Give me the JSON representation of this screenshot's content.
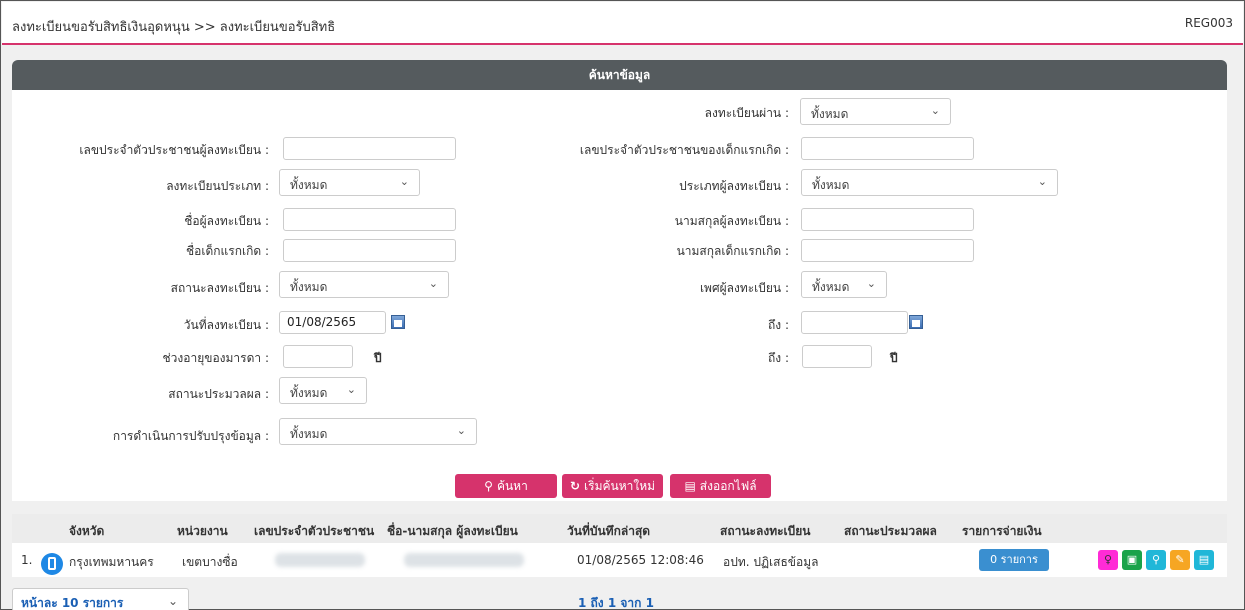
{
  "header": {
    "breadcrumb": "ลงทะเบียนขอรับสิทธิเงินอุดหนุน >>  ลงทะเบียนขอรับสิทธิ",
    "code": "REG003"
  },
  "search": {
    "title": "ค้นหาข้อมูล",
    "via_label": "ลงทะเบียนผ่าน :",
    "via_value": "ทั้งหมด",
    "registrant_id_label": "เลขประจำตัวประชาชนผู้ลงทะเบียน :",
    "registrant_id_value": "",
    "child_id_label": "เลขประจำตัวประชาชนของเด็กแรกเกิด :",
    "child_id_value": "",
    "reg_type_label": "ลงทะเบียนประเภท :",
    "reg_type_value": "ทั้งหมด",
    "registrant_type_label": "ประเภทผู้ลงทะเบียน :",
    "registrant_type_value": "ทั้งหมด",
    "registrant_name_label": "ชื่อผู้ลงทะเบียน :",
    "registrant_name_value": "",
    "registrant_surname_label": "นามสกุลผู้ลงทะเบียน :",
    "registrant_surname_value": "",
    "child_name_label": "ชื่อเด็กแรกเกิด :",
    "child_name_value": "",
    "child_surname_label": "นามสกุลเด็กแรกเกิด :",
    "child_surname_value": "",
    "reg_status_label": "สถานะลงทะเบียน :",
    "reg_status_value": "ทั้งหมด",
    "gender_label": "เพศผู้ลงทะเบียน :",
    "gender_value": "ทั้งหมด",
    "reg_date_label": "วันที่ลงทะเบียน :",
    "reg_date_value": "01/08/2565",
    "to_label": "ถึง :",
    "reg_date_to_value": "",
    "mother_age_label": "ช่วงอายุของมารดา :",
    "mother_age_from": "",
    "year_unit": "ปี",
    "mother_age_to": "",
    "process_status_label": "สถานะประมวลผล :",
    "process_status_value": "ทั้งหมด",
    "update_action_label": "การดำเนินการปรับปรุงข้อมูล :",
    "update_action_value": "ทั้งหมด",
    "search_button": "ค้นหา",
    "reset_button": "เริ่มค้นหาใหม่",
    "export_button": "ส่งออกไฟล์"
  },
  "table": {
    "headers": [
      "จังหวัด",
      "หน่วยงาน",
      "เลขประจำตัวประชาชน",
      "ชื่อ-นามสกุล ผู้ลงทะเบียน",
      "วันที่บันทึกล่าสุด",
      "สถานะลงทะเบียน",
      "สถานะประมวลผล",
      "รายการจ่ายเงิน"
    ],
    "rows": [
      {
        "index": "1.",
        "province": "กรุงเทพมหานคร",
        "agency": "เขตบางซื่อ",
        "last_saved": "01/08/2565 12:08:46",
        "reg_status": "อปท. ปฏิเสธข้อมูล",
        "payments": "0 รายการ"
      }
    ]
  },
  "pagination": {
    "per_page": "หน้าละ 10 รายการ",
    "info": "1 ถึง 1 จาก 1"
  },
  "colors": {
    "accent": "#d6336c",
    "panel_header": "#555b5e",
    "link": "#1a5fb4"
  }
}
